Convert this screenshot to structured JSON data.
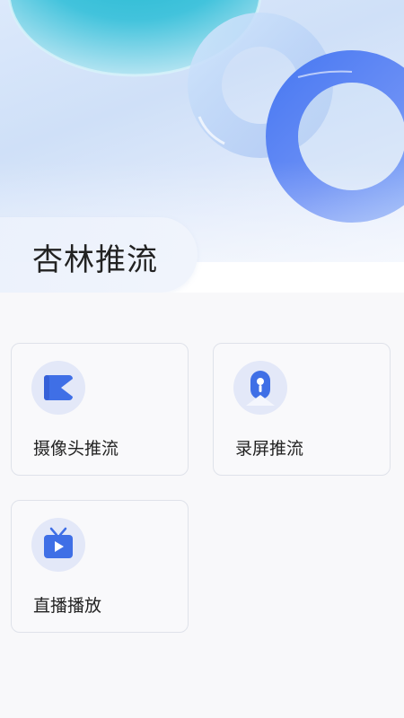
{
  "app": {
    "title": "杏林推流"
  },
  "menu": [
    {
      "id": "camera",
      "label": "摄像头推流",
      "icon": "camera-stream-icon"
    },
    {
      "id": "screen",
      "label": "录屏推流",
      "icon": "screen-record-icon"
    },
    {
      "id": "play",
      "label": "直播播放",
      "icon": "tv-play-icon"
    }
  ],
  "colors": {
    "icon_primary": "#3f6fe6",
    "icon_circle": "#e3e8f8",
    "card_border": "#dfe2ea",
    "background": "#f8f8fa"
  }
}
